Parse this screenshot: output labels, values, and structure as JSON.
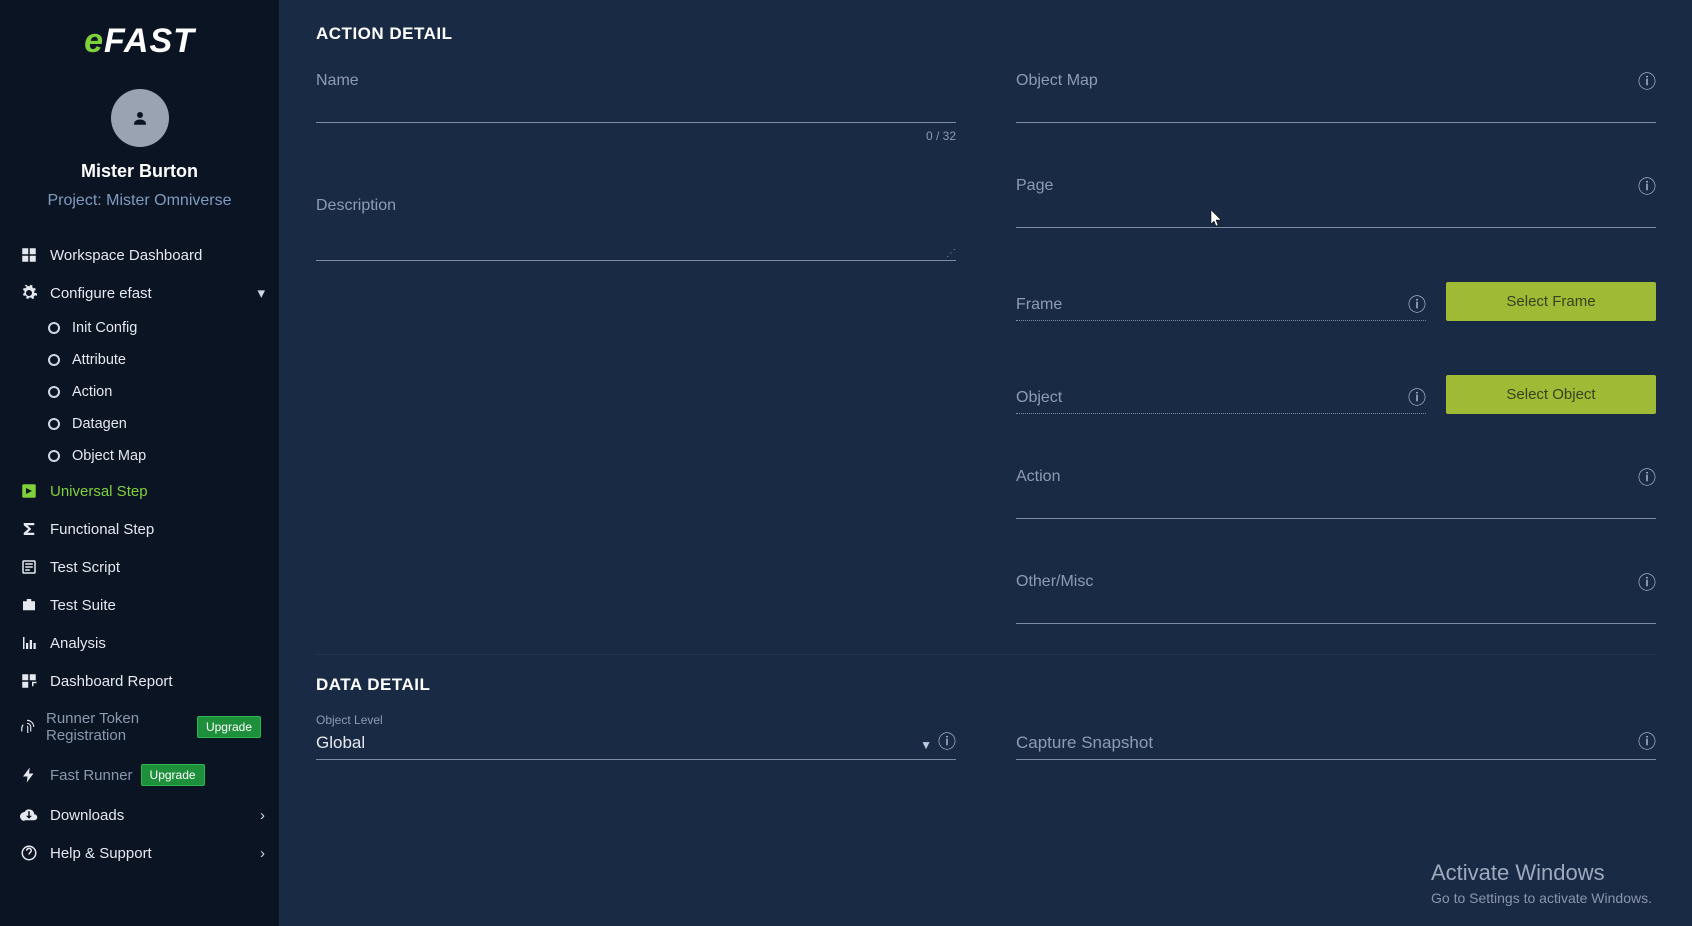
{
  "logo": {
    "part1": "e",
    "part2": "FAST"
  },
  "user": {
    "name": "Mister Burton",
    "project": "Project: Mister Omniverse"
  },
  "nav": {
    "workspace": "Workspace Dashboard",
    "configure": "Configure efast",
    "init_config": "Init Config",
    "attribute": "Attribute",
    "action": "Action",
    "datagen": "Datagen",
    "object_map": "Object Map",
    "universal_step": "Universal Step",
    "functional_step": "Functional Step",
    "test_script": "Test Script",
    "test_suite": "Test Suite",
    "analysis": "Analysis",
    "dashboard_report": "Dashboard Report",
    "runner_token": "Runner Token Registration",
    "fast_runner": "Fast Runner",
    "downloads": "Downloads",
    "help": "Help & Support",
    "upgrade": "Upgrade"
  },
  "section": {
    "action_detail": "ACTION DETAIL",
    "data_detail": "DATA DETAIL"
  },
  "fields": {
    "name": "Name",
    "name_counter": "0 / 32",
    "description": "Description",
    "object_map": "Object Map",
    "page": "Page",
    "frame": "Frame",
    "object": "Object",
    "action": "Action",
    "other": "Other/Misc",
    "object_level_label": "Object Level",
    "object_level_value": "Global",
    "capture": "Capture Snapshot"
  },
  "buttons": {
    "select_frame": "Select Frame",
    "select_object": "Select Object"
  },
  "watermark": {
    "t1": "Activate Windows",
    "t2": "Go to Settings to activate Windows."
  }
}
